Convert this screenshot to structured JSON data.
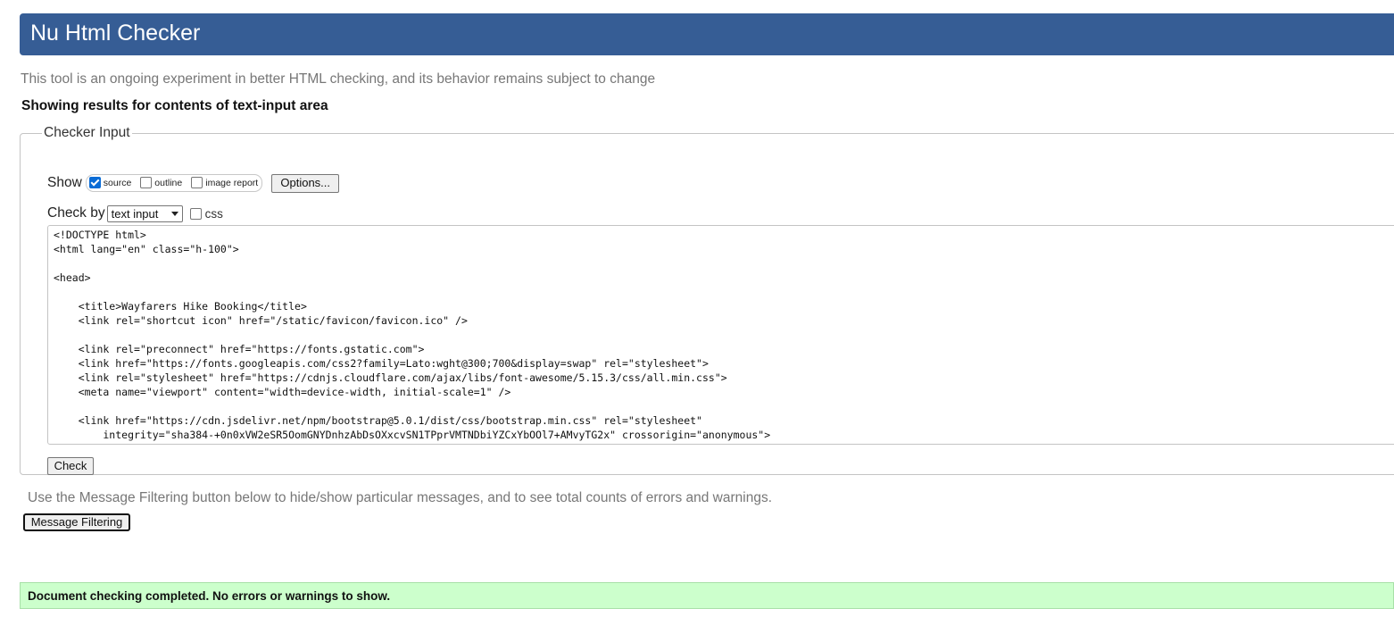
{
  "header": {
    "title": "Nu Html Checker"
  },
  "subtitle": "This tool is an ongoing experiment in better HTML checking, and its behavior remains subject to change",
  "results_heading": "Showing results for contents of text-input area",
  "checker_input": {
    "legend": "Checker Input",
    "show_label": "Show",
    "show_options": {
      "source": {
        "label": "source",
        "checked": true
      },
      "outline": {
        "label": "outline",
        "checked": false
      },
      "image_report": {
        "label": "image report",
        "checked": false
      }
    },
    "options_button": "Options...",
    "check_by_label": "Check by",
    "check_by_selected": "text input",
    "css_option": {
      "label": "css",
      "checked": false
    },
    "source_text": "<!DOCTYPE html>\n<html lang=\"en\" class=\"h-100\">\n\n<head>\n\n    <title>Wayfarers Hike Booking</title>\n    <link rel=\"shortcut icon\" href=\"/static/favicon/favicon.ico\" />\n\n    <link rel=\"preconnect\" href=\"https://fonts.gstatic.com\">\n    <link href=\"https://fonts.googleapis.com/css2?family=Lato:wght@300;700&display=swap\" rel=\"stylesheet\">\n    <link rel=\"stylesheet\" href=\"https://cdnjs.cloudflare.com/ajax/libs/font-awesome/5.15.3/css/all.min.css\">\n    <meta name=\"viewport\" content=\"width=device-width, initial-scale=1\" />\n\n    <link href=\"https://cdn.jsdelivr.net/npm/bootstrap@5.0.1/dist/css/bootstrap.min.css\" rel=\"stylesheet\"\n        integrity=\"sha384-+0n0xVW2eSR5OomGNYDnhzAbDsOXxcvSN1TPprVMTNDbiYZCxYbOOl7+AMvyTG2x\" crossorigin=\"anonymous\">",
    "check_button": "Check"
  },
  "filter_note": "Use the Message Filtering button below to hide/show particular messages, and to see total counts of errors and warnings.",
  "filter_button": "Message Filtering",
  "success_message": "Document checking completed. No errors or warnings to show.",
  "colors": {
    "header_bg": "#365d95",
    "success_bg": "#ccffcc",
    "checkbox_checked": "#0a6cd6"
  }
}
